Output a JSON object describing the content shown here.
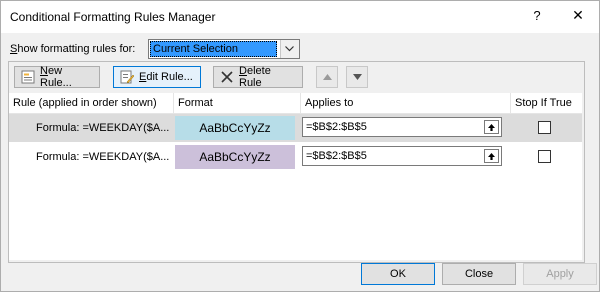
{
  "window": {
    "title": "Conditional Formatting Rules Manager",
    "help_label": "?",
    "close_label": "✕"
  },
  "filter": {
    "label_prefix": "S",
    "label_rest": "how formatting rules for:",
    "selected": "Current Selection"
  },
  "toolbar": {
    "new_rule_mnemonic": "N",
    "new_rule_rest": "ew Rule...",
    "edit_rule_mnemonic": "E",
    "edit_rule_rest": "dit Rule...",
    "delete_rule_mnemonic": "D",
    "delete_rule_rest": "elete Rule"
  },
  "table": {
    "headers": {
      "rule": "Rule (applied in order shown)",
      "format": "Format",
      "applies_to": "Applies to",
      "stop_if_true": "Stop If True"
    },
    "rows": [
      {
        "rule": "Formula: =WEEKDAY($A...",
        "format_preview": "AaBbCcYyZz",
        "format_color": "#b7dde8",
        "applies_to": "=$B$2:$B$5",
        "stop_if_true": false,
        "selected": true
      },
      {
        "rule": "Formula: =WEEKDAY($A...",
        "format_preview": "AaBbCcYyZz",
        "format_color": "#ccc0da",
        "applies_to": "=$B$2:$B$5",
        "stop_if_true": false,
        "selected": false
      }
    ]
  },
  "footer": {
    "ok": "OK",
    "close": "Close",
    "apply": "Apply"
  }
}
